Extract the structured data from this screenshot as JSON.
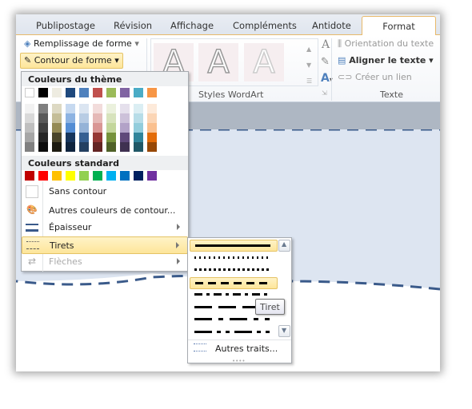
{
  "tabs": [
    {
      "label": "Publipostage"
    },
    {
      "label": "Révision"
    },
    {
      "label": "Affichage"
    },
    {
      "label": "Compléments"
    },
    {
      "label": "Antidote"
    },
    {
      "label": "Format",
      "active": true
    }
  ],
  "ribbon": {
    "fill_label": "Remplissage de forme",
    "outline_label": "Contour de forme",
    "wordart_group": "Styles WordArt",
    "text_group": "Texte",
    "orientation": "Orientation du texte",
    "align": "Aligner le texte",
    "link": "Créer un lien",
    "wordart_letter": "A"
  },
  "menu": {
    "theme_header": "Couleurs du thème",
    "standard_header": "Couleurs standard",
    "theme_colors": [
      "#ffffff",
      "#000000",
      "#eeece1",
      "#1f497d",
      "#4f81bd",
      "#c0504d",
      "#9bbb59",
      "#8064a2",
      "#4bacc6",
      "#f79646"
    ],
    "theme_shades": [
      [
        "#f2f2f2",
        "#d9d9d9",
        "#bfbfbf",
        "#a6a6a6",
        "#808080"
      ],
      [
        "#7f7f7f",
        "#595959",
        "#404040",
        "#262626",
        "#0d0d0d"
      ],
      [
        "#ddd9c3",
        "#c4bd97",
        "#948a54",
        "#4a452a",
        "#1d1b11"
      ],
      [
        "#c6d9f0",
        "#8db3e2",
        "#548dd4",
        "#17365d",
        "#0f243e"
      ],
      [
        "#dbe5f1",
        "#b8cce4",
        "#95b3d7",
        "#366092",
        "#244061"
      ],
      [
        "#f2dcdb",
        "#e5b9b7",
        "#d99694",
        "#953734",
        "#632423"
      ],
      [
        "#ebf1dd",
        "#d7e3bc",
        "#c3d69b",
        "#76923c",
        "#4f6128"
      ],
      [
        "#e5e0ec",
        "#ccc1d9",
        "#b2a2c7",
        "#5f497a",
        "#3f3151"
      ],
      [
        "#dbeef3",
        "#b7dde8",
        "#92cddc",
        "#31859b",
        "#205867"
      ],
      [
        "#fdeada",
        "#fbd5b5",
        "#fac08f",
        "#e36c09",
        "#974806"
      ]
    ],
    "standard_colors": [
      "#c00000",
      "#ff0000",
      "#ffc000",
      "#ffff00",
      "#92d050",
      "#00b050",
      "#00b0f0",
      "#0070c0",
      "#002060",
      "#7030a0"
    ],
    "items": [
      {
        "label": "Sans contour",
        "icon": "no-outline-swatch"
      },
      {
        "label": "Autres couleurs de contour...",
        "icon": "palette-icon"
      },
      {
        "label": "Épaisseur",
        "icon": "weight-icon",
        "submenu": true
      },
      {
        "label": "Tirets",
        "icon": "dash-icon",
        "submenu": true,
        "highlighted": true
      },
      {
        "label": "Flèches",
        "icon": "arrows-icon",
        "submenu": true,
        "disabled": true
      }
    ]
  },
  "dashes": {
    "styles": [
      "solid",
      "round-dot",
      "square-dot",
      "dash",
      "dash-dot",
      "long-dash",
      "long-dash-dot",
      "long-dash-dot-dot"
    ],
    "selected": "solid",
    "hovered": "dash",
    "more_label": "Autres traits...",
    "tooltip": "Tiret"
  },
  "colors": {
    "accent": "#fde59a",
    "shape_fill": "#dde5f1",
    "shape_line": "#3a5a8a"
  }
}
